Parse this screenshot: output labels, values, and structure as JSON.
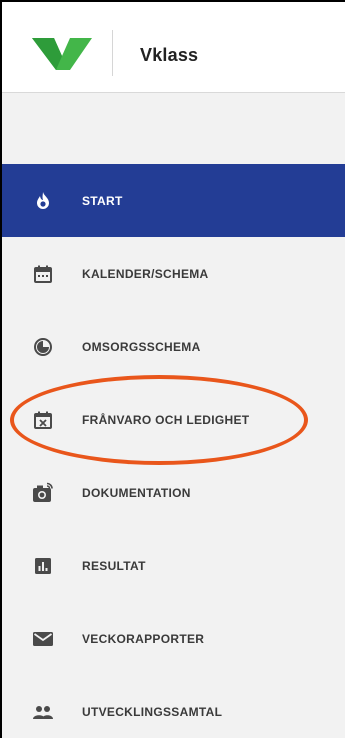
{
  "header": {
    "brand": "Vklass",
    "logo": "vklass-logo",
    "accent": "#5cb85c"
  },
  "menu": {
    "active_color": "#233d95",
    "items": [
      {
        "label": "START",
        "icon": "flame-icon",
        "active": true
      },
      {
        "label": "KALENDER/SCHEMA",
        "icon": "calendar-icon",
        "active": false
      },
      {
        "label": "OMSORGSSCHEMA",
        "icon": "clock-icon",
        "active": false
      },
      {
        "label": "FRÅNVARO OCH LEDIGHET",
        "icon": "calendar-x-icon",
        "active": false
      },
      {
        "label": "DOKUMENTATION",
        "icon": "camera-icon",
        "active": false
      },
      {
        "label": "RESULTAT",
        "icon": "bar-chart-icon",
        "active": false
      },
      {
        "label": "VECKORAPPORTER",
        "icon": "envelope-icon",
        "active": false
      },
      {
        "label": "UTVECKLINGSSAMTAL",
        "icon": "people-icon",
        "active": false
      }
    ]
  },
  "annotation": {
    "color": "#e9561b",
    "highlights": "FRÅNVARO OCH LEDIGHET"
  }
}
